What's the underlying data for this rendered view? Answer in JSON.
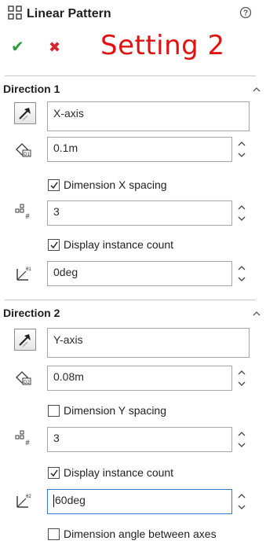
{
  "header": {
    "title": "Linear Pattern"
  },
  "annotation": "Setting 2",
  "colors": {
    "accept": "#2e9a3e",
    "cancel": "#d7232b",
    "annotation": "#e01212",
    "active_field_border": "#2f7fd3"
  },
  "direction1": {
    "heading": "Direction 1",
    "direction_ref": "X-axis",
    "spacing": "0.1m",
    "dimension_spacing_label": "Dimension X spacing",
    "dimension_spacing_checked": true,
    "instances": "3",
    "display_count_label": "Display instance count",
    "display_count_checked": true,
    "angle": "0deg"
  },
  "direction2": {
    "heading": "Direction 2",
    "direction_ref": "Y-axis",
    "spacing": "0.08m",
    "dimension_spacing_label": "Dimension Y spacing",
    "dimension_spacing_checked": false,
    "instances": "3",
    "display_count_label": "Display instance count",
    "display_count_checked": true,
    "angle": "60deg",
    "dimension_angle_label": "Dimension angle between axes",
    "dimension_angle_checked": false
  },
  "icons": [
    "linear-pattern-icon",
    "help-icon",
    "accept-icon",
    "cancel-icon",
    "direction-arrow-icon",
    "spacing-icon",
    "instances-icon",
    "angle-icon",
    "collapse-icon",
    "spinner-icon"
  ]
}
